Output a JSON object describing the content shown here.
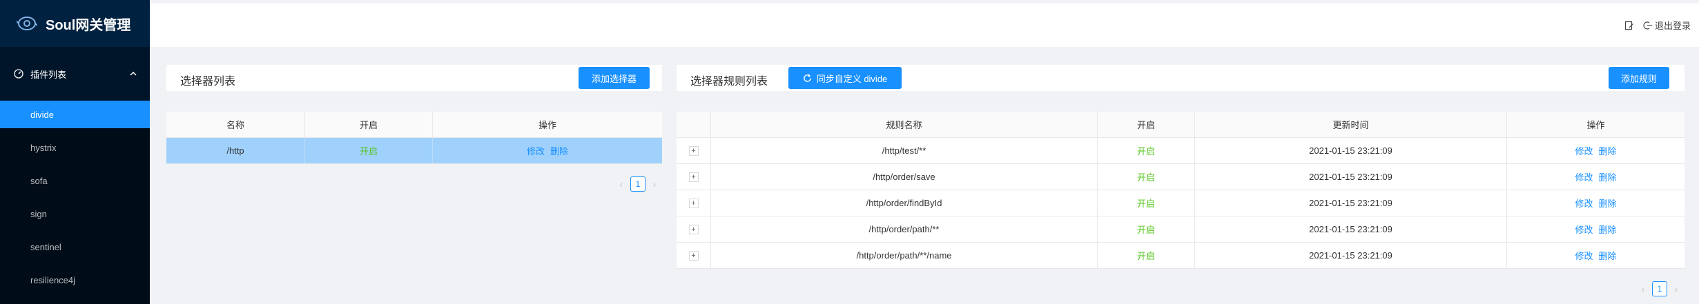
{
  "app": {
    "title": "Soul网关管理"
  },
  "sidebar": {
    "submenu_title": "插件列表",
    "items": [
      {
        "label": "divide",
        "active": true
      },
      {
        "label": "hystrix",
        "active": false
      },
      {
        "label": "sofa",
        "active": false
      },
      {
        "label": "sign",
        "active": false
      },
      {
        "label": "sentinel",
        "active": false
      },
      {
        "label": "resilience4j",
        "active": false
      }
    ]
  },
  "header": {
    "logout_label": "退出登录"
  },
  "selector_panel": {
    "title": "选择器列表",
    "add_button": "添加选择器",
    "columns": [
      "名称",
      "开启",
      "操作"
    ],
    "rows": [
      {
        "name": "/http",
        "status": "开启",
        "edit": "修改",
        "delete": "删除"
      }
    ],
    "page": "1"
  },
  "rule_panel": {
    "title": "选择器规则列表",
    "sync_button": "同步自定义 divide",
    "add_button": "添加规则",
    "columns": [
      "规则名称",
      "开启",
      "更新时间",
      "操作"
    ],
    "rows": [
      {
        "name": "/http/test/**",
        "status": "开启",
        "time": "2021-01-15 23:21:09",
        "edit": "修改",
        "delete": "删除"
      },
      {
        "name": "/http/order/save",
        "status": "开启",
        "time": "2021-01-15 23:21:09",
        "edit": "修改",
        "delete": "删除"
      },
      {
        "name": "/http/order/findById",
        "status": "开启",
        "time": "2021-01-15 23:21:09",
        "edit": "修改",
        "delete": "删除"
      },
      {
        "name": "/http/order/path/**",
        "status": "开启",
        "time": "2021-01-15 23:21:09",
        "edit": "修改",
        "delete": "删除"
      },
      {
        "name": "/http/order/path/**/name",
        "status": "开启",
        "time": "2021-01-15 23:21:09",
        "edit": "修改",
        "delete": "删除"
      }
    ],
    "page": "1"
  },
  "colors": {
    "primary": "#1890ff",
    "sidebar_bg": "#001529",
    "enabled": "#52c41a",
    "selected_row": "#a0d1fd"
  }
}
